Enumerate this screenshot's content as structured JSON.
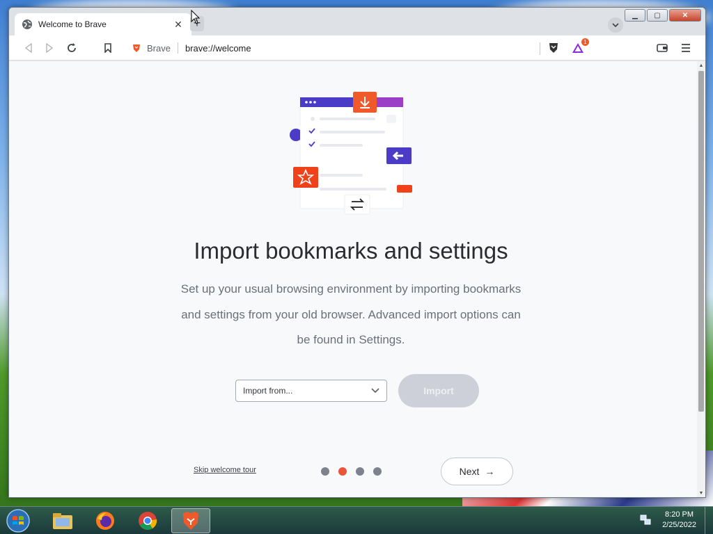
{
  "browser": {
    "tab": {
      "title": "Welcome to Brave",
      "close_glyph": "✕",
      "icon": "globe-icon"
    },
    "new_tab_glyph": "+",
    "window_controls": {
      "minimize": "▁",
      "maximize": "▢",
      "close": "✕"
    },
    "toolbar": {
      "site_name": "Brave",
      "url": "brave://welcome",
      "rewards_badge": "1"
    }
  },
  "welcome": {
    "heading": "Import bookmarks and settings",
    "description": "Set up your usual browsing environment by importing bookmarks and settings from your old browser. Advanced import options can be found in Settings.",
    "import_select": {
      "placeholder": "Import from..."
    },
    "import_button": "Import",
    "skip_link": "Skip welcome tour",
    "next_button": "Next",
    "next_arrow": "→",
    "steps": {
      "total": 4,
      "active_index": 1
    }
  },
  "taskbar": {
    "apps": [
      "file-explorer",
      "firefox",
      "chrome",
      "brave"
    ],
    "active_app": "brave",
    "clock": {
      "time": "8:20 PM",
      "date": "2/25/2022"
    }
  },
  "colors": {
    "brand_orange": "#f05a2a",
    "accent_purple": "#4b3cc8",
    "active_dot": "#e9553b"
  }
}
